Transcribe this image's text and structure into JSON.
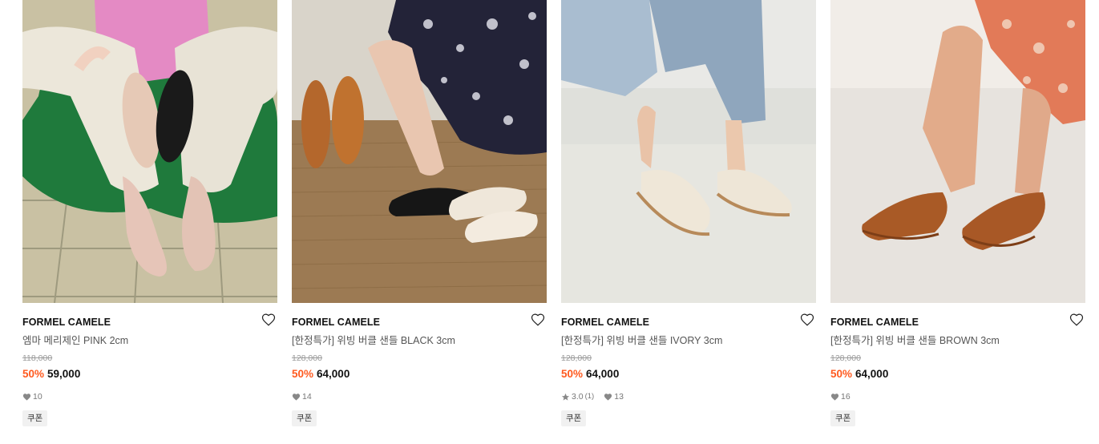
{
  "products": [
    {
      "brand": "FORMEL CAMELE",
      "name": "엠마 메리제인 PINK 2cm",
      "original_price": "118,000",
      "discount": "50%",
      "sale_price": "59,000",
      "likes": "10",
      "coupon": "쿠폰",
      "image_icon": "product-photo-mary-jane-pink"
    },
    {
      "brand": "FORMEL CAMELE",
      "name": "[한정특가] 위빙 버클 샌들 BLACK 3cm",
      "original_price": "128,000",
      "discount": "50%",
      "sale_price": "64,000",
      "likes": "14",
      "coupon": "쿠폰",
      "image_icon": "product-photo-weaving-sandal-black"
    },
    {
      "brand": "FORMEL CAMELE",
      "name": "[한정특가] 위빙 버클 샌들 IVORY 3cm",
      "original_price": "128,000",
      "discount": "50%",
      "sale_price": "64,000",
      "rating": "3.0",
      "reviews": "(1)",
      "likes": "13",
      "coupon": "쿠폰",
      "image_icon": "product-photo-weaving-sandal-ivory"
    },
    {
      "brand": "FORMEL CAMELE",
      "name": "[한정특가] 위빙 버클 샌들 BROWN 3cm",
      "original_price": "128,000",
      "discount": "50%",
      "sale_price": "64,000",
      "likes": "16",
      "coupon": "쿠폰",
      "image_icon": "product-photo-weaving-sandal-brown"
    }
  ],
  "colors": {
    "discount": "#ff5a1f",
    "text": "#111111",
    "muted": "#9a9a9a",
    "coupon_bg": "#f1f1f1"
  }
}
